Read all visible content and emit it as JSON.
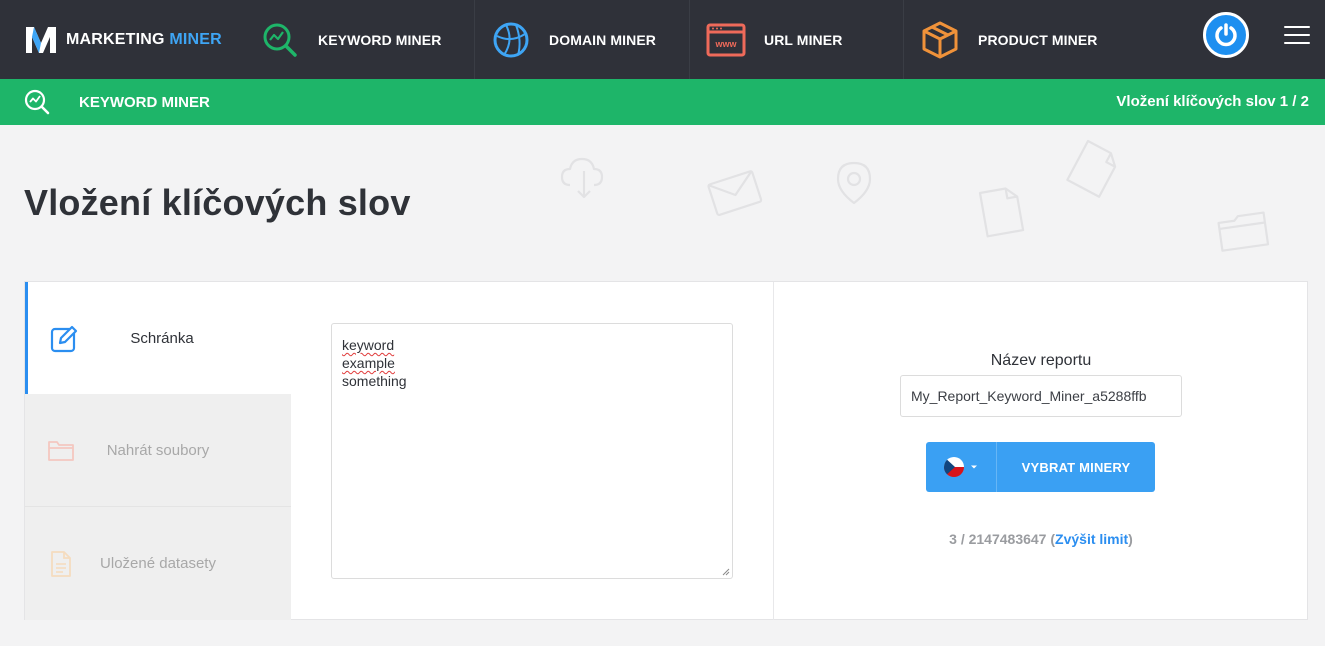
{
  "brand": {
    "name_part1": "MARKETING",
    "name_part2": "MINER"
  },
  "nav": {
    "keyword": "KEYWORD MINER",
    "domain": "DOMAIN MINER",
    "url": "URL MINER",
    "url_icon_text": "www",
    "product": "PRODUCT MINER"
  },
  "subbar": {
    "title": "KEYWORD MINER",
    "step": "Vložení klíčových slov 1 / 2"
  },
  "page": {
    "title": "Vložení klíčových slov"
  },
  "tabs": {
    "clipboard": "Schránka",
    "upload": "Nahrát soubory",
    "datasets": "Uložené datasety"
  },
  "keywords": [
    "keyword",
    "example",
    "something"
  ],
  "report": {
    "label": "Název reportu",
    "name": "My_Report_Keyword_Miner_a5288ffb"
  },
  "actions": {
    "choose_miners": "VYBRAT MINERY"
  },
  "limit": {
    "usage": "3 / 2147483647",
    "open_paren": " (",
    "link": "Zvýšit limit",
    "close_paren": ")"
  },
  "colors": {
    "nav_bg": "#2f3139",
    "green": "#1eb569",
    "blue": "#3aa0f3",
    "accent": "#3ea5f5"
  }
}
